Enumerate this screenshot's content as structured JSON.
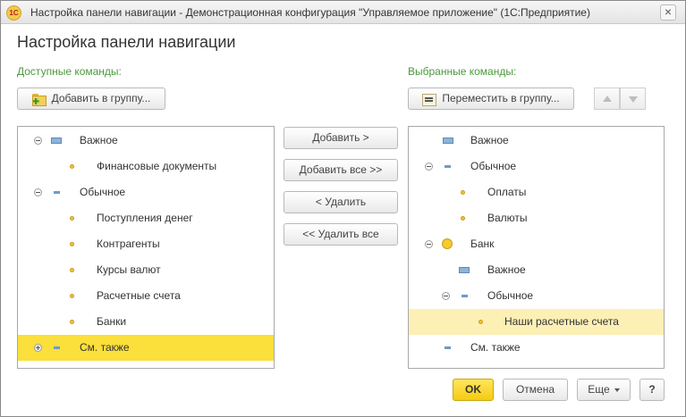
{
  "window": {
    "logo_text": "1С",
    "title": "Настройка панели навигации - Демонстрационная конфигурация \"Управляемое приложение\" (1С:Предприятие)",
    "close_glyph": "×"
  },
  "form": {
    "title": "Настройка панели навигации"
  },
  "available": {
    "label": "Доступные команды:",
    "add_to_group_label": "Добавить в группу...",
    "items": [
      {
        "label": "Важное"
      },
      {
        "label": "Финансовые документы"
      },
      {
        "label": "Обычное"
      },
      {
        "label": "Поступления денег"
      },
      {
        "label": "Контрагенты"
      },
      {
        "label": "Курсы валют"
      },
      {
        "label": "Расчетные счета"
      },
      {
        "label": "Банки"
      },
      {
        "label": "См. также"
      }
    ]
  },
  "actions": {
    "add": "Добавить >",
    "add_all": "Добавить все >>",
    "remove": "< Удалить",
    "remove_all": "<< Удалить все"
  },
  "selected": {
    "label": "Выбранные команды:",
    "move_to_group_label": "Переместить в группу...",
    "items": [
      {
        "label": "Важное"
      },
      {
        "label": "Обычное"
      },
      {
        "label": "Оплаты"
      },
      {
        "label": "Валюты"
      },
      {
        "label": "Банк"
      },
      {
        "label": "Важное"
      },
      {
        "label": "Обычное"
      },
      {
        "label": "Наши расчетные счета"
      },
      {
        "label": "См. также"
      }
    ]
  },
  "footer": {
    "ok": "OK",
    "cancel": "Отмена",
    "more": "Еще",
    "help": "?"
  },
  "colors": {
    "accent_green": "#4a9a3c",
    "selection_strong": "#fbdf3a",
    "selection_soft": "#fdf0b5"
  }
}
